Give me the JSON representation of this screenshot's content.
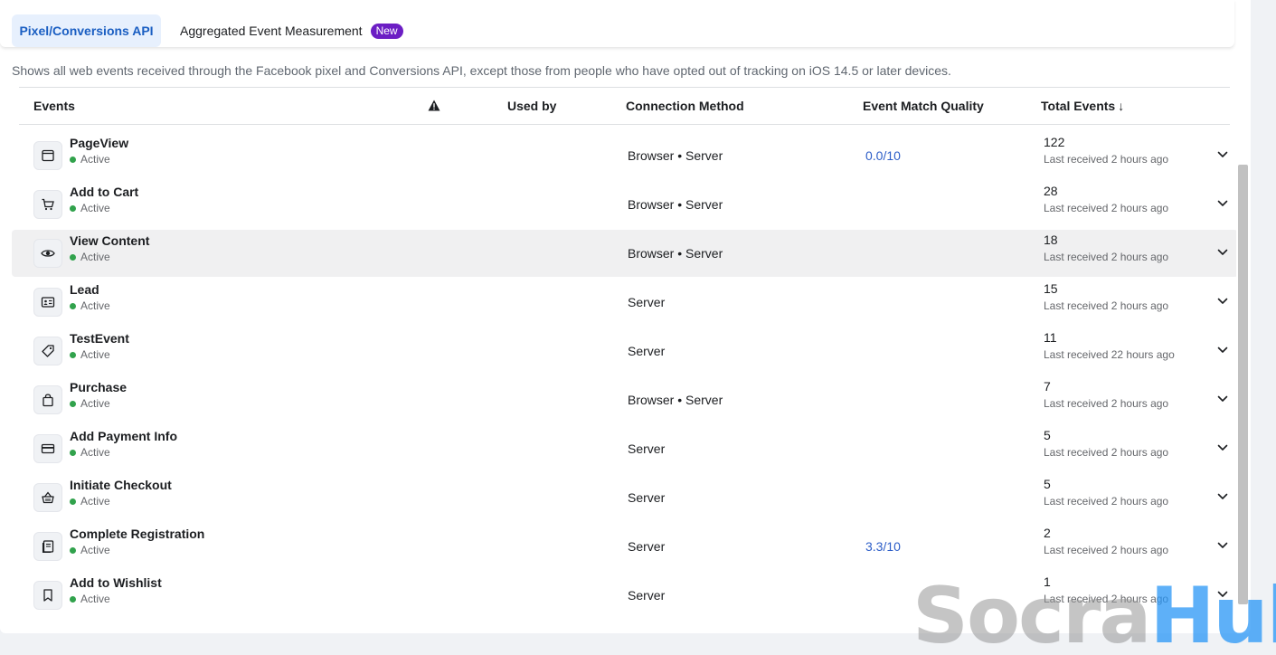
{
  "tabs": {
    "active_label": "Pixel/Conversions API",
    "second_label": "Aggregated Event Measurement",
    "new_badge": "New"
  },
  "description": "Shows all web events received through the Facebook pixel and Conversions API, except those from people who have opted out of tracking on iOS 14.5 or later devices.",
  "columns": {
    "events": "Events",
    "used_by": "Used by",
    "connection_method": "Connection Method",
    "event_match_quality": "Event Match Quality",
    "total_events": "Total Events",
    "sort_arrow": "↓"
  },
  "rows": [
    {
      "name": "PageView",
      "status": "Active",
      "icon": "browser-window-icon",
      "method": "Browser • Server",
      "emq": "0.0/10",
      "total": "122",
      "last": "Last received 2 hours ago"
    },
    {
      "name": "Add to Cart",
      "status": "Active",
      "icon": "cart-icon",
      "method": "Browser • Server",
      "emq": "",
      "total": "28",
      "last": "Last received 2 hours ago"
    },
    {
      "name": "View Content",
      "status": "Active",
      "icon": "eye-icon",
      "method": "Browser • Server",
      "emq": "",
      "total": "18",
      "last": "Last received 2 hours ago"
    },
    {
      "name": "Lead",
      "status": "Active",
      "icon": "id-card-icon",
      "method": "Server",
      "emq": "",
      "total": "15",
      "last": "Last received 2 hours ago"
    },
    {
      "name": "TestEvent",
      "status": "Active",
      "icon": "tag-icon",
      "method": "Server",
      "emq": "",
      "total": "11",
      "last": "Last received 22 hours ago"
    },
    {
      "name": "Purchase",
      "status": "Active",
      "icon": "shopping-bag-icon",
      "method": "Browser • Server",
      "emq": "",
      "total": "7",
      "last": "Last received 2 hours ago"
    },
    {
      "name": "Add Payment Info",
      "status": "Active",
      "icon": "credit-card-icon",
      "method": "Server",
      "emq": "",
      "total": "5",
      "last": "Last received 2 hours ago"
    },
    {
      "name": "Initiate Checkout",
      "status": "Active",
      "icon": "basket-icon",
      "method": "Server",
      "emq": "",
      "total": "5",
      "last": "Last received 2 hours ago"
    },
    {
      "name": "Complete Registration",
      "status": "Active",
      "icon": "registration-form-icon",
      "method": "Server",
      "emq": "3.3/10",
      "total": "2",
      "last": "Last received 2 hours ago"
    },
    {
      "name": "Add to Wishlist",
      "status": "Active",
      "icon": "bookmark-icon",
      "method": "Server",
      "emq": "",
      "total": "1",
      "last": "Last received 2 hours ago"
    }
  ],
  "watermark": {
    "part1": "Socra",
    "part2": "Hub"
  },
  "colors": {
    "accent": "#1a5ec2",
    "badge": "#6c1ec4",
    "active_dot": "#31a24c",
    "emq_link": "#2d5ec8"
  }
}
